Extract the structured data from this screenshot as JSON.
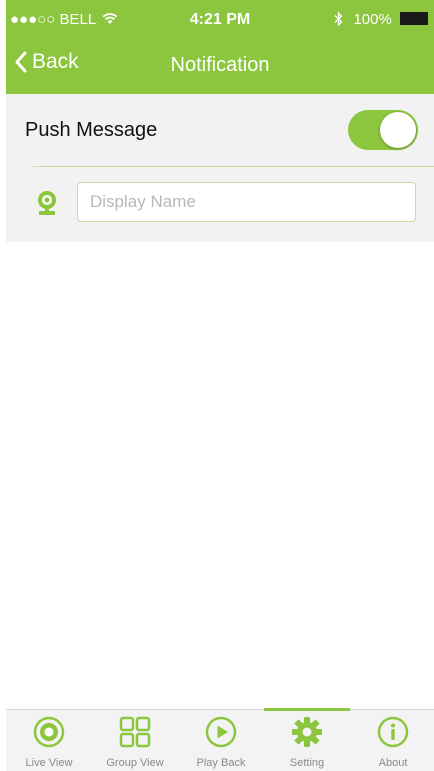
{
  "status_bar": {
    "carrier": "●●●○○ BELL",
    "time": "4:21 PM",
    "battery": "100%"
  },
  "nav": {
    "back_label": "Back",
    "title": "Notification"
  },
  "settings": {
    "push_label": "Push Message",
    "push_enabled": true,
    "display_name_placeholder": "Display Name",
    "display_name_value": ""
  },
  "tabs": [
    {
      "label": "Live View",
      "icon": "live-view-icon"
    },
    {
      "label": "Group View",
      "icon": "grid-icon"
    },
    {
      "label": "Play Back",
      "icon": "play-icon"
    },
    {
      "label": "Setting",
      "icon": "gear-icon",
      "active": true
    },
    {
      "label": "About",
      "icon": "info-icon"
    }
  ],
  "colors": {
    "accent": "#8cc63e",
    "panel": "#f2f2f2"
  }
}
